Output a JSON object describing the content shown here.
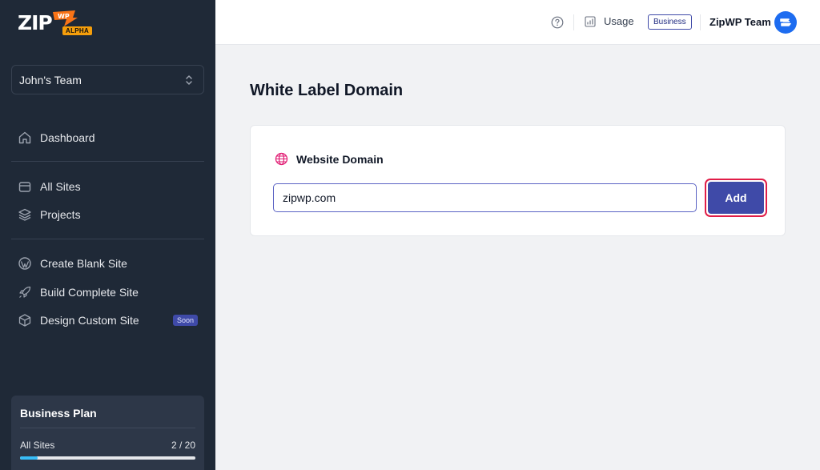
{
  "brand": {
    "logo_text": "ZIP",
    "logo_wp": "WP",
    "logo_badge": "ALPHA"
  },
  "sidebar": {
    "team_selector": "John's Team",
    "nav": [
      {
        "label": "Dashboard",
        "icon": "home-icon"
      },
      {
        "label": "All Sites",
        "icon": "folder-icon"
      },
      {
        "label": "Projects",
        "icon": "layers-icon"
      },
      {
        "label": "Create Blank Site",
        "icon": "wordpress-icon"
      },
      {
        "label": "Build Complete Site",
        "icon": "rocket-icon"
      },
      {
        "label": "Design Custom Site",
        "icon": "cube-icon",
        "badge": "Soon"
      }
    ],
    "plan": {
      "title": "Business Plan",
      "metric_label": "All Sites",
      "metric_value": "2 / 20",
      "usage_fraction": 0.1
    }
  },
  "header": {
    "usage_label": "Usage",
    "plan_badge": "Business",
    "team_name": "ZipWP Team"
  },
  "main": {
    "title": "White Label Domain",
    "card": {
      "heading": "Website Domain",
      "input_value": "zipwp.com",
      "add_label": "Add"
    }
  },
  "colors": {
    "sidebar_bg": "#1f2937",
    "accent": "#3f4aa8",
    "highlight": "#e11d48",
    "progress": "#38bdf8"
  }
}
